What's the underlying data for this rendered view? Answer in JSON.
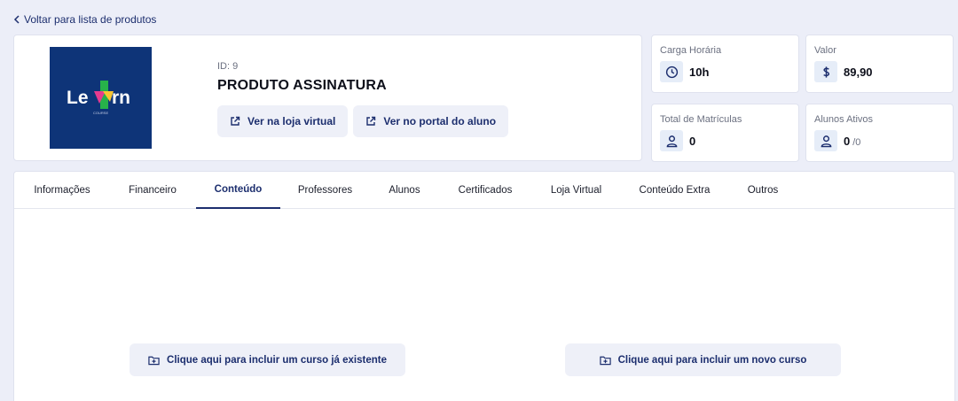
{
  "back_link": "Voltar para lista de produtos",
  "product": {
    "logo_text_left": "Le",
    "logo_text_right": "rn",
    "logo_sub": "COURSE",
    "id_label": "ID: 9",
    "name": "PRODUTO ASSINATURA",
    "links": [
      {
        "label": "Ver na loja virtual",
        "icon": "external-link-icon"
      },
      {
        "label": "Ver no portal do aluno",
        "icon": "external-link-icon"
      }
    ]
  },
  "stats": {
    "carga": {
      "label": "Carga Horária",
      "value": "10h",
      "icon": "clock-icon"
    },
    "valor": {
      "label": "Valor",
      "value": "89,90",
      "icon": "dollar-icon"
    },
    "matriculas": {
      "label": "Total de Matrículas",
      "value": "0",
      "icon": "user-icon"
    },
    "ativos": {
      "label": "Alunos Ativos",
      "value": "0",
      "sub": "/0",
      "icon": "user-icon"
    }
  },
  "tabs": [
    {
      "label": "Informações"
    },
    {
      "label": "Financeiro"
    },
    {
      "label": "Conteúdo",
      "active": true
    },
    {
      "label": "Professores"
    },
    {
      "label": "Alunos"
    },
    {
      "label": "Certificados"
    },
    {
      "label": "Loja Virtual"
    },
    {
      "label": "Conteúdo Extra"
    },
    {
      "label": "Outros"
    }
  ],
  "actions": {
    "include_existing": "Clique aqui para incluir um curso já existente",
    "include_new": "Clique aqui para incluir um novo curso"
  },
  "colors": {
    "accent": "#1c2e6e",
    "background": "#eceef8",
    "logo_bg": "#0e3478"
  }
}
